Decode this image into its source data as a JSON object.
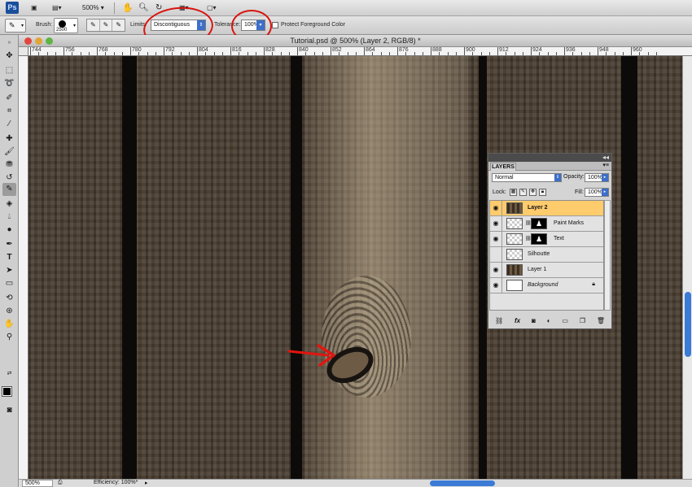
{
  "app_bar": {
    "logo": "Ps",
    "zoom": "500%",
    "icons": [
      "mini-bridge-icon",
      "screen-mode-icon",
      "hand-tool-icon",
      "zoom-tool-icon",
      "rotate-view-icon",
      "arrange-documents-icon"
    ]
  },
  "options_bar": {
    "brush_label": "Brush:",
    "brush_size": "2500",
    "limits_label": "Limits:",
    "limits_value": "Discontiguous",
    "tolerance_label": "Tolerance:",
    "tolerance_value": "100%",
    "protect_label": "Protect Foreground Color",
    "annotation_color": "#d8130f"
  },
  "document": {
    "title": "Tutorial.psd @ 500% (Layer 2, RGB/8) *",
    "ruler_labels": [
      "744",
      "756",
      "768",
      "780",
      "792",
      "804",
      "816",
      "828",
      "840",
      "852",
      "864",
      "876",
      "888",
      "900",
      "912",
      "924",
      "936",
      "948",
      "960"
    ]
  },
  "status_bar": {
    "zoom": "500%",
    "info": "Efficiency: 100%*"
  },
  "layers_panel": {
    "tab": "LAYERS",
    "blend_mode": "Normal",
    "opacity_label": "Opacity:",
    "opacity": "100%",
    "lock_label": "Lock:",
    "fill_label": "Fill:",
    "fill": "100%",
    "layers": [
      {
        "name": "Layer 2",
        "visible": true,
        "selected": true,
        "thumb": "wood"
      },
      {
        "name": "Paint Marks",
        "visible": true,
        "selected": false,
        "thumb": "checker",
        "mask": "figure"
      },
      {
        "name": "Text",
        "visible": true,
        "selected": false,
        "thumb": "checker-smart",
        "mask": "figure"
      },
      {
        "name": "Silhoutte",
        "visible": false,
        "selected": false,
        "thumb": "checker-smart"
      },
      {
        "name": "Layer 1",
        "visible": true,
        "selected": false,
        "thumb": "wood"
      },
      {
        "name": "Background",
        "visible": true,
        "selected": false,
        "thumb": "white",
        "locked": true
      }
    ],
    "footer_icons": [
      "link-layers-icon",
      "fx-icon",
      "add-mask-icon",
      "adjustment-layer-icon",
      "new-group-icon",
      "new-layer-icon",
      "trash-icon"
    ],
    "selected_color": "#fecb6d"
  }
}
